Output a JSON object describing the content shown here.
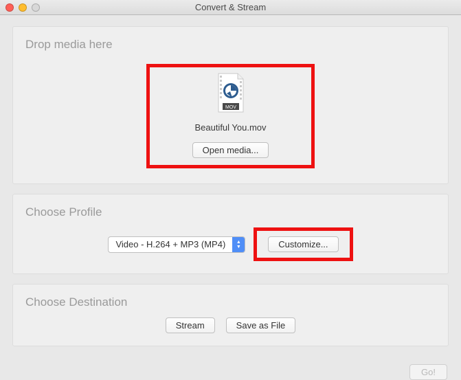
{
  "window": {
    "title": "Convert & Stream"
  },
  "drop": {
    "title": "Drop media here",
    "file_name": "Beautiful You.mov",
    "file_ext": "MOV",
    "open_label": "Open media..."
  },
  "profile": {
    "title": "Choose Profile",
    "selected": "Video - H.264 + MP3 (MP4)",
    "customize_label": "Customize..."
  },
  "destination": {
    "title": "Choose Destination",
    "stream_label": "Stream",
    "save_label": "Save as File"
  },
  "footer": {
    "go_label": "Go!"
  }
}
